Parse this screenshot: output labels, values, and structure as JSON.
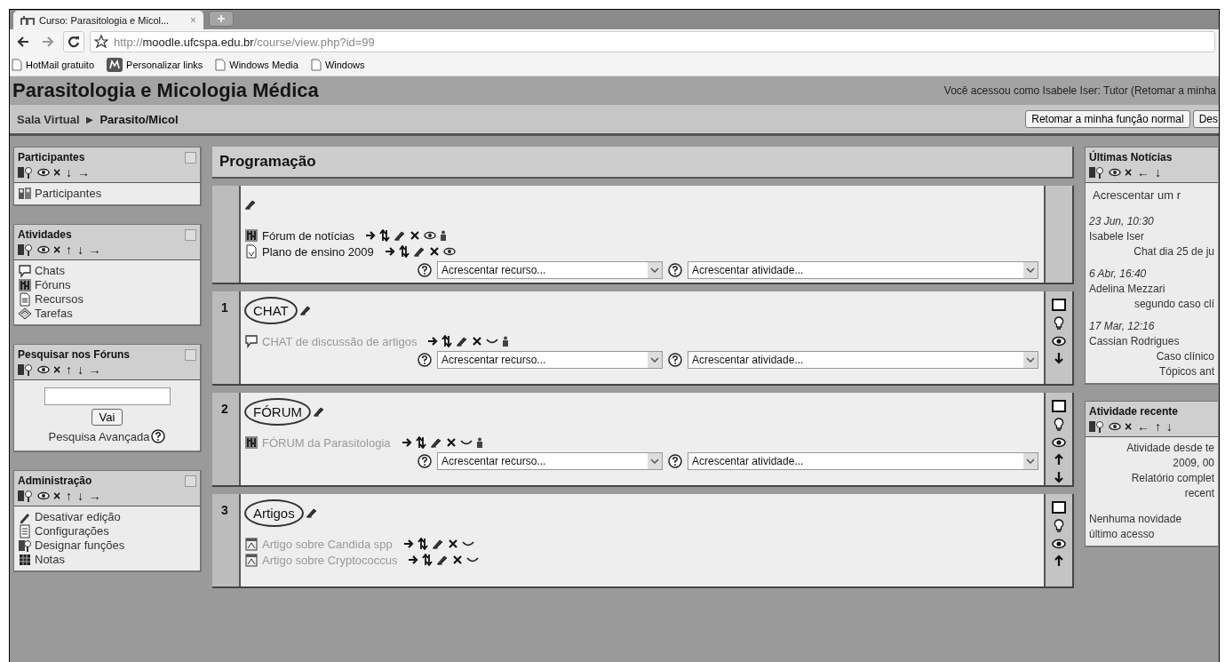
{
  "browser": {
    "tab": {
      "title": "Curso: Parasitologia e Micol...",
      "close": "×"
    },
    "address": {
      "scheme": "http://",
      "host": "moodle.ufcspa.edu.br",
      "path": "/course/view.php?id=99"
    },
    "bookmarks": [
      {
        "label": "HotMail gratuito",
        "kind": "page"
      },
      {
        "label": "Personalizar links",
        "kind": "app"
      },
      {
        "label": "Windows Media",
        "kind": "page"
      },
      {
        "label": "Windows",
        "kind": "page"
      }
    ]
  },
  "header": {
    "title": "Parasitologia e Micologia Médica",
    "login_info": "Você acessou como Isabele Iser: Tutor (Retomar a minha",
    "breadcrumb": [
      "Sala Virtual",
      "Parasito/Micol"
    ],
    "separator": "►",
    "buttons": [
      "Retomar a minha função normal",
      "Des"
    ]
  },
  "left_blocks": [
    {
      "title": "Participantes",
      "controls": "× ↓ →",
      "kind": "list",
      "items": [
        {
          "label": "Participantes",
          "kind": "participants"
        }
      ]
    },
    {
      "title": "Atividades",
      "controls": "× ↑ ↓ →",
      "kind": "list",
      "items": [
        {
          "label": "Chats",
          "kind": "chat"
        },
        {
          "label": "Fóruns",
          "kind": "forum"
        },
        {
          "label": "Recursos",
          "kind": "resource"
        },
        {
          "label": "Tarefas",
          "kind": "assignment"
        }
      ]
    },
    {
      "title": "Pesquisar nos Fóruns",
      "controls": "× ↑ ↓ →",
      "kind": "search",
      "button": "Vai",
      "link": "Pesquisa Avançada"
    },
    {
      "title": "Administração",
      "controls": "× ↑ ↓ →",
      "kind": "list",
      "items": [
        {
          "label": "Desativar edição",
          "kind": "edit"
        },
        {
          "label": "Configurações",
          "kind": "settings"
        },
        {
          "label": "Designar funções",
          "kind": "roles"
        },
        {
          "label": "Notas",
          "kind": "grades"
        }
      ]
    }
  ],
  "center": {
    "title": "Programação",
    "sections": [
      {
        "editable": false,
        "items": [
          {
            "label": "Fórum de notícias",
            "kind": "forum",
            "visible": true,
            "groups": true
          },
          {
            "label": "Plano de ensino 2009",
            "kind": "page",
            "visible": true,
            "groups": false
          }
        ],
        "add_resource": "Acrescentar recurso...",
        "add_activity": "Acrescentar atividade..."
      },
      {
        "number": "1",
        "title": "CHAT",
        "circled": true,
        "editable": true,
        "move_up": false,
        "move_down": true,
        "items": [
          {
            "label": "CHAT de discussão de artigos",
            "kind": "chat",
            "visible": false,
            "groups": true
          }
        ],
        "add_resource": "Acrescentar recurso...",
        "add_activity": "Acrescentar atividade..."
      },
      {
        "number": "2",
        "title": "FÓRUM",
        "circled": true,
        "editable": true,
        "move_up": true,
        "move_down": true,
        "items": [
          {
            "label": "FÓRUM da Parasitologia",
            "kind": "forum",
            "visible": false,
            "groups": true
          }
        ],
        "add_resource": "Acrescentar recurso...",
        "add_activity": "Acrescentar atividade..."
      },
      {
        "number": "3",
        "title": "Artigos",
        "circled": true,
        "editable": true,
        "move_up": true,
        "move_down": false,
        "items": [
          {
            "label": "Artigo sobre Candida spp",
            "kind": "pdf",
            "visible": false,
            "groups": false
          },
          {
            "label": "Artigo sobre Cryptococcus",
            "kind": "pdf",
            "visible": false,
            "groups": false
          }
        ]
      }
    ]
  },
  "right_blocks": [
    {
      "title": "Últimas Notícias",
      "controls": "× ← ↓",
      "kind": "news",
      "add_link": "Acrescentar um r",
      "posts": [
        {
          "date": "23 Jun, 10:30",
          "author": "Isabele Iser",
          "lines": [
            "Chat dia 25 de ju"
          ]
        },
        {
          "date": "6 Abr, 16:40",
          "author": "Adelina Mezzari",
          "lines": [
            "segundo caso clí"
          ]
        },
        {
          "date": "17 Mar, 12:16",
          "author": "Cassian Rodrigues",
          "lines": [
            "Caso clínico",
            "Tópicos ant"
          ]
        }
      ]
    },
    {
      "title": "Atividade recente",
      "controls": "× ← ↑ ↓",
      "kind": "recent",
      "summary": [
        "Atividade desde te",
        "2009, 00",
        "Relatório complet",
        "recent"
      ],
      "note": [
        "Nenhuma novidade",
        "último acesso"
      ]
    }
  ]
}
